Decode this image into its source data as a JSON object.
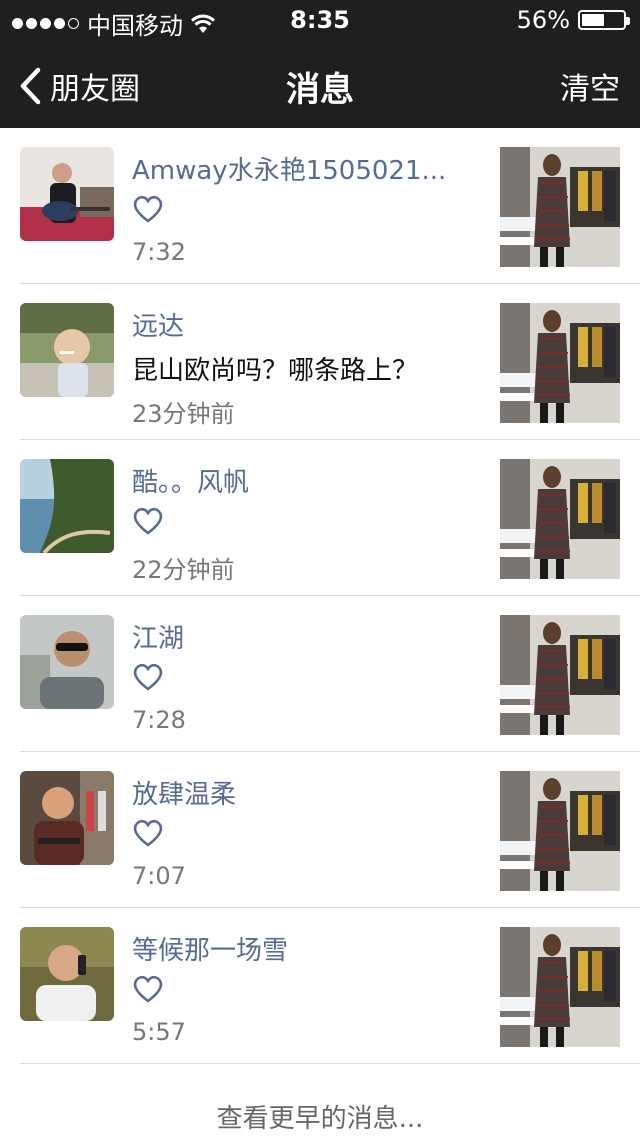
{
  "status_bar": {
    "carrier": "中国移动",
    "time": "8:35",
    "battery_percent": "56%",
    "battery_level": 0.56,
    "signal_bars_filled": 4
  },
  "nav": {
    "back_label": "朋友圈",
    "title": "消息",
    "clear_label": "清空"
  },
  "messages": [
    {
      "name": "Amway水永艳1505021...",
      "type": "like",
      "comment": "",
      "time": "7:32",
      "avatar_icon": "man-with-guitar-avatar"
    },
    {
      "name": "远达",
      "type": "comment",
      "comment": "昆山欧尚吗？哪条路上？",
      "time": "23分钟前",
      "avatar_icon": "child-avatar"
    },
    {
      "name": "酷。。风帆",
      "type": "like",
      "comment": "",
      "time": "22分钟前",
      "avatar_icon": "mountain-road-avatar"
    },
    {
      "name": "江湖",
      "type": "like",
      "comment": "",
      "time": "7:28",
      "avatar_icon": "man-sunglasses-avatar"
    },
    {
      "name": "放肆温柔",
      "type": "like",
      "comment": "",
      "time": "7:07",
      "avatar_icon": "man-shop-avatar"
    },
    {
      "name": "等候那一场雪",
      "type": "like",
      "comment": "",
      "time": "5:57",
      "avatar_icon": "man-phone-avatar"
    }
  ],
  "footer": {
    "load_more": "查看更早的消息..."
  }
}
